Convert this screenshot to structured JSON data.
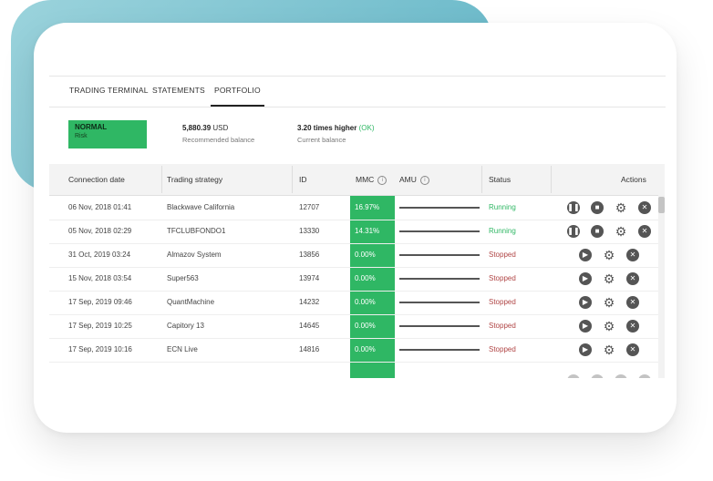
{
  "tabs": [
    {
      "label": "TRADING TERMINAL"
    },
    {
      "label": "STATEMENTS"
    },
    {
      "label": "PORTFOLIO"
    }
  ],
  "risk": {
    "label": "NORMAL",
    "sublabel": "Risk",
    "color": "#2fb764"
  },
  "recommended": {
    "value": "5,880.39",
    "unit": "USD",
    "label": "Recommended balance"
  },
  "current": {
    "value": "3.20 times higher",
    "status": "(OK)",
    "label": "Current balance"
  },
  "table": {
    "headers": {
      "date": "Connection date",
      "strategy": "Trading strategy",
      "id": "ID",
      "mmc": "MMC",
      "amu": "AMU",
      "status": "Status",
      "actions": "Actions"
    },
    "rows": [
      {
        "date": "06 Nov, 2018 01:41",
        "strategy": "Blackwave California",
        "id": "12707",
        "mmc": "16.97%",
        "status": "Running"
      },
      {
        "date": "05 Nov, 2018 02:29",
        "strategy": "TFCLUBFONDO1",
        "id": "13330",
        "mmc": "14.31%",
        "status": "Running"
      },
      {
        "date": "31 Oct, 2019 03:24",
        "strategy": "Almazov System",
        "id": "13856",
        "mmc": "0.00%",
        "status": "Stopped"
      },
      {
        "date": "15 Nov, 2018 03:54",
        "strategy": "Super563",
        "id": "13974",
        "mmc": "0.00%",
        "status": "Stopped"
      },
      {
        "date": "17 Sep, 2019 09:46",
        "strategy": "QuantMachine",
        "id": "14232",
        "mmc": "0.00%",
        "status": "Stopped"
      },
      {
        "date": "17 Sep, 2019 10:25",
        "strategy": "Capitory 13",
        "id": "14645",
        "mmc": "0.00%",
        "status": "Stopped"
      },
      {
        "date": "17 Sep, 2019 10:16",
        "strategy": "ECN Live",
        "id": "14816",
        "mmc": "0.00%",
        "status": "Stopped"
      }
    ]
  },
  "colors": {
    "accent": "#2fb764",
    "stopped": "#b04545",
    "teal": "#5fb3c5"
  }
}
